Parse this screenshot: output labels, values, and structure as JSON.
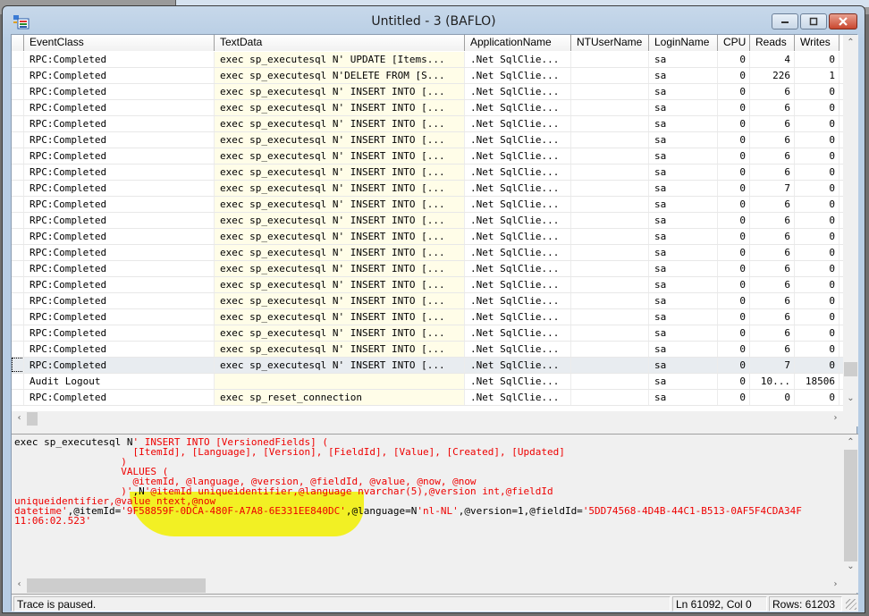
{
  "window": {
    "title": "Untitled - 3 (BAFLO)",
    "icon": "profiler-trace-icon",
    "buttons": [
      "minimize",
      "restore",
      "close"
    ]
  },
  "grid": {
    "columns": [
      "EventClass",
      "TextData",
      "ApplicationName",
      "NTUserName",
      "LoginName",
      "CPU",
      "Reads",
      "Writes"
    ],
    "rows": [
      {
        "event": "RPC:Completed",
        "text": "exec sp_executesql N' UPDATE [Items...",
        "app": ".Net SqlClie...",
        "nt": "",
        "login": "sa",
        "cpu": "0",
        "reads": "4",
        "writes": "0"
      },
      {
        "event": "RPC:Completed",
        "text": "exec sp_executesql N'DELETE FROM [S...",
        "app": ".Net SqlClie...",
        "nt": "",
        "login": "sa",
        "cpu": "0",
        "reads": "226",
        "writes": "1"
      },
      {
        "event": "RPC:Completed",
        "text": "exec sp_executesql N' INSERT INTO [...",
        "app": ".Net SqlClie...",
        "nt": "",
        "login": "sa",
        "cpu": "0",
        "reads": "6",
        "writes": "0"
      },
      {
        "event": "RPC:Completed",
        "text": "exec sp_executesql N' INSERT INTO [...",
        "app": ".Net SqlClie...",
        "nt": "",
        "login": "sa",
        "cpu": "0",
        "reads": "6",
        "writes": "0"
      },
      {
        "event": "RPC:Completed",
        "text": "exec sp_executesql N' INSERT INTO [...",
        "app": ".Net SqlClie...",
        "nt": "",
        "login": "sa",
        "cpu": "0",
        "reads": "6",
        "writes": "0"
      },
      {
        "event": "RPC:Completed",
        "text": "exec sp_executesql N' INSERT INTO [...",
        "app": ".Net SqlClie...",
        "nt": "",
        "login": "sa",
        "cpu": "0",
        "reads": "6",
        "writes": "0"
      },
      {
        "event": "RPC:Completed",
        "text": "exec sp_executesql N' INSERT INTO [...",
        "app": ".Net SqlClie...",
        "nt": "",
        "login": "sa",
        "cpu": "0",
        "reads": "6",
        "writes": "0"
      },
      {
        "event": "RPC:Completed",
        "text": "exec sp_executesql N' INSERT INTO [...",
        "app": ".Net SqlClie...",
        "nt": "",
        "login": "sa",
        "cpu": "0",
        "reads": "6",
        "writes": "0"
      },
      {
        "event": "RPC:Completed",
        "text": "exec sp_executesql N' INSERT INTO [...",
        "app": ".Net SqlClie...",
        "nt": "",
        "login": "sa",
        "cpu": "0",
        "reads": "7",
        "writes": "0"
      },
      {
        "event": "RPC:Completed",
        "text": "exec sp_executesql N' INSERT INTO [...",
        "app": ".Net SqlClie...",
        "nt": "",
        "login": "sa",
        "cpu": "0",
        "reads": "6",
        "writes": "0"
      },
      {
        "event": "RPC:Completed",
        "text": "exec sp_executesql N' INSERT INTO [...",
        "app": ".Net SqlClie...",
        "nt": "",
        "login": "sa",
        "cpu": "0",
        "reads": "6",
        "writes": "0"
      },
      {
        "event": "RPC:Completed",
        "text": "exec sp_executesql N' INSERT INTO [...",
        "app": ".Net SqlClie...",
        "nt": "",
        "login": "sa",
        "cpu": "0",
        "reads": "6",
        "writes": "0"
      },
      {
        "event": "RPC:Completed",
        "text": "exec sp_executesql N' INSERT INTO [...",
        "app": ".Net SqlClie...",
        "nt": "",
        "login": "sa",
        "cpu": "0",
        "reads": "6",
        "writes": "0"
      },
      {
        "event": "RPC:Completed",
        "text": "exec sp_executesql N' INSERT INTO [...",
        "app": ".Net SqlClie...",
        "nt": "",
        "login": "sa",
        "cpu": "0",
        "reads": "6",
        "writes": "0"
      },
      {
        "event": "RPC:Completed",
        "text": "exec sp_executesql N' INSERT INTO [...",
        "app": ".Net SqlClie...",
        "nt": "",
        "login": "sa",
        "cpu": "0",
        "reads": "6",
        "writes": "0"
      },
      {
        "event": "RPC:Completed",
        "text": "exec sp_executesql N' INSERT INTO [...",
        "app": ".Net SqlClie...",
        "nt": "",
        "login": "sa",
        "cpu": "0",
        "reads": "6",
        "writes": "0"
      },
      {
        "event": "RPC:Completed",
        "text": "exec sp_executesql N' INSERT INTO [...",
        "app": ".Net SqlClie...",
        "nt": "",
        "login": "sa",
        "cpu": "0",
        "reads": "6",
        "writes": "0"
      },
      {
        "event": "RPC:Completed",
        "text": "exec sp_executesql N' INSERT INTO [...",
        "app": ".Net SqlClie...",
        "nt": "",
        "login": "sa",
        "cpu": "0",
        "reads": "6",
        "writes": "0"
      },
      {
        "event": "RPC:Completed",
        "text": "exec sp_executesql N' INSERT INTO [...",
        "app": ".Net SqlClie...",
        "nt": "",
        "login": "sa",
        "cpu": "0",
        "reads": "6",
        "writes": "0"
      },
      {
        "event": "RPC:Completed",
        "text": "exec sp_executesql N' INSERT INTO [...",
        "app": ".Net SqlClie...",
        "nt": "",
        "login": "sa",
        "cpu": "0",
        "reads": "7",
        "writes": "0",
        "selected": true
      },
      {
        "event": "Audit Logout",
        "text": "",
        "app": ".Net SqlClie...",
        "nt": "",
        "login": "sa",
        "cpu": "0",
        "reads": "10...",
        "writes": "18506"
      },
      {
        "event": "RPC:Completed",
        "text": "exec sp_reset_connection",
        "app": ".Net SqlClie...",
        "nt": "",
        "login": "sa",
        "cpu": "0",
        "reads": "0",
        "writes": "0"
      }
    ]
  },
  "detail": {
    "lines": [
      [
        {
          "c": "k",
          "t": "exec sp_executesql "
        },
        {
          "c": "k",
          "t": "N"
        },
        {
          "c": "r",
          "t": "' INSERT INTO [VersionedFields] ("
        }
      ],
      [
        {
          "c": "r",
          "t": "                    [ItemId], [Language], [Version], [FieldId], [Value], [Created], [Updated]"
        }
      ],
      [
        {
          "c": "r",
          "t": "                  )"
        }
      ],
      [
        {
          "c": "r",
          "t": "                  VALUES ("
        }
      ],
      [
        {
          "c": "r",
          "t": "                    @itemId, @language, @version, @fieldId, @value, @now, @now"
        }
      ],
      [
        {
          "c": "r",
          "t": "                  )'"
        },
        {
          "c": "k",
          "t": ",N"
        },
        {
          "c": "r",
          "t": "'@itemId uniqueidentifier,@language nvarchar(5),@version int,@fieldId"
        }
      ],
      [
        {
          "c": "r",
          "t": "uniqueidentifier,@value ntext,@now"
        }
      ],
      [
        {
          "c": "r",
          "t": "datetime'"
        },
        {
          "c": "k",
          "t": ",@itemId="
        },
        {
          "c": "r",
          "t": "'9F58859F-0DCA-480F-A7A8-6E331EE840DC'"
        },
        {
          "c": "k",
          "t": ",@language=N"
        },
        {
          "c": "r",
          "t": "'nl-NL'"
        },
        {
          "c": "k",
          "t": ",@version=1,@fieldId="
        },
        {
          "c": "r",
          "t": "'5DD74568-4D4B-44C1-B513-0AF5F4CDA34F"
        }
      ],
      [
        {
          "c": "r",
          "t": "11:06:02.523'"
        }
      ]
    ]
  },
  "status": {
    "message": "Trace is paused.",
    "position": "Ln 61092, Col 0",
    "rows": "Rows: 61203"
  }
}
